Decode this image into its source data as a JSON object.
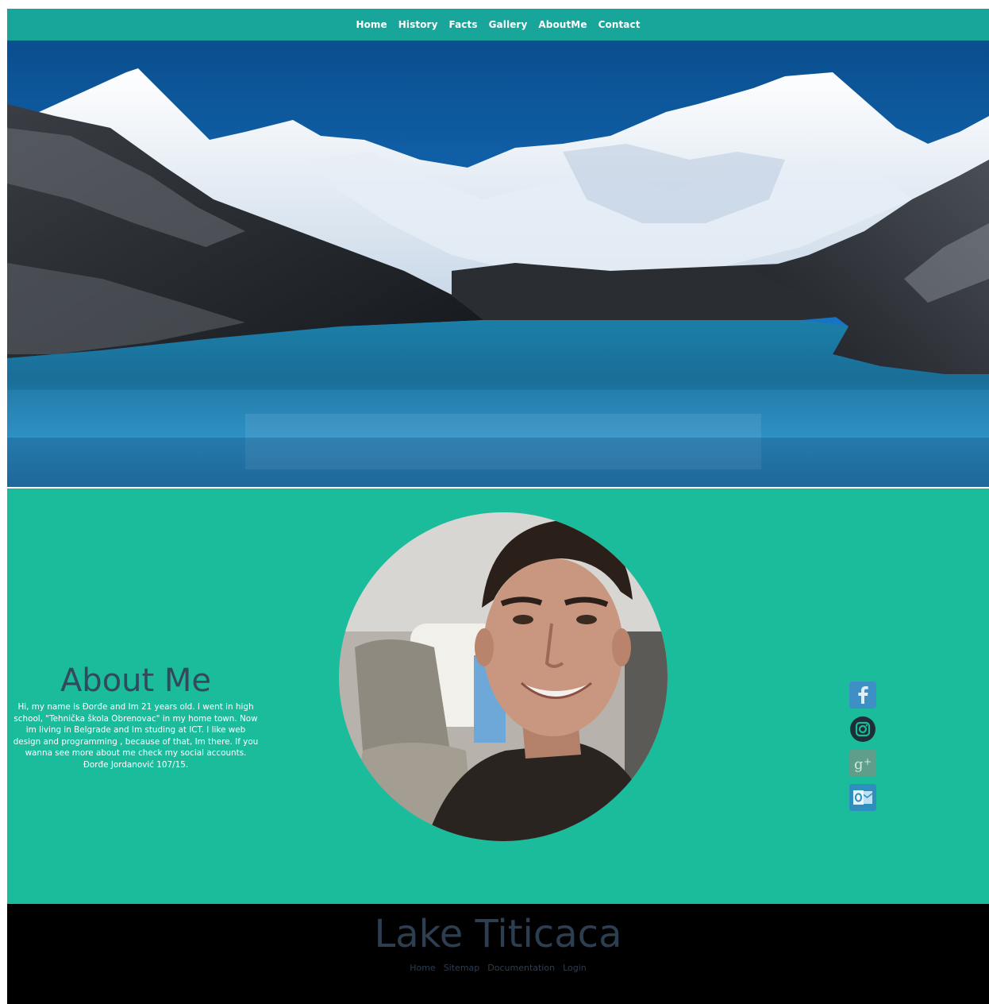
{
  "nav": {
    "items": [
      "Home",
      "History",
      "Facts",
      "Gallery",
      "AboutMe",
      "Contact"
    ]
  },
  "about": {
    "title": "About Me",
    "body": "Hi, my name is Đorđe and Im 21 years old. I went in high school, \"Tehnička škola Obrenovac\" in my home town. Now im living in Belgrade and Im studing at ICT. I like web design and programming , because of that, Im there. If you wanna see more about me check my social accounts. Đorđe Jordanović 107/15."
  },
  "socials": [
    "facebook-icon",
    "instagram-icon",
    "google-plus-icon",
    "outlook-icon"
  ],
  "footer": {
    "title": "Lake Titicaca",
    "links": [
      "Home",
      "Sitemap",
      "Documentation",
      "Login"
    ]
  },
  "colors": {
    "nav_bg": "#18a59a",
    "about_bg": "#1abc9c",
    "heading": "#34495e",
    "footer_bg": "#000000",
    "footer_text": "#2c3e50"
  }
}
